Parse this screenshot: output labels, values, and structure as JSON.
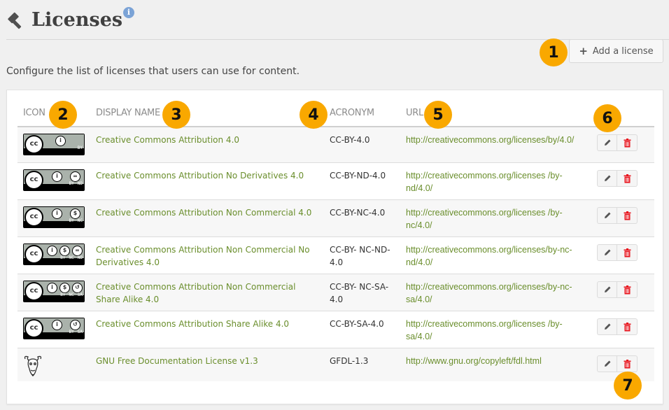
{
  "header": {
    "title": "Licenses",
    "icon": "gavel-icon",
    "info_icon": "info-icon",
    "info_glyph": "i"
  },
  "toolbar": {
    "add_label": "Add a license",
    "add_icon": "+"
  },
  "description": "Configure the list of licenses that users can use for content.",
  "table": {
    "columns": [
      "Icon",
      "Display name",
      "Acronym",
      "URL"
    ],
    "rows": [
      {
        "icon": "cc-by",
        "tags": [
          "BY"
        ],
        "name": "Creative Commons Attribution 4.0",
        "acronym": "CC-BY-4.0",
        "url": "http://creativecommons.org/licenses/by/4.0/"
      },
      {
        "icon": "cc-by-nd",
        "tags": [
          "BY",
          "ND"
        ],
        "name": "Creative Commons Attribution No Derivatives 4.0",
        "acronym": "CC-BY-ND-4.0",
        "url": "http://creativecommons.org/licenses /by-nd/4.0/"
      },
      {
        "icon": "cc-by-nc",
        "tags": [
          "BY",
          "NC"
        ],
        "name": "Creative Commons Attribution Non Commercial 4.0",
        "acronym": "CC-BY-NC-4.0",
        "url": "http://creativecommons.org/licenses /by-nc/4.0/"
      },
      {
        "icon": "cc-by-nc-nd",
        "tags": [
          "BY",
          "NC",
          "ND"
        ],
        "name": "Creative Commons Attribution Non Commercial No Derivatives 4.0",
        "acronym": "CC-BY- NC-ND-4.0",
        "url": "http://creativecommons.org/licenses/by-nc- nd/4.0/"
      },
      {
        "icon": "cc-by-nc-sa",
        "tags": [
          "BY",
          "NC",
          "SA"
        ],
        "name": "Creative Commons Attribution Non Commercial Share Alike 4.0",
        "acronym": "CC-BY- NC-SA-4.0",
        "url": "http://creativecommons.org/licenses/by-nc- sa/4.0/"
      },
      {
        "icon": "cc-by-sa",
        "tags": [
          "BY",
          "SA"
        ],
        "name": "Creative Commons Attribution Share Alike 4.0",
        "acronym": "CC-BY-SA-4.0",
        "url": "http://creativecommons.org/licenses /by-sa/4.0/"
      },
      {
        "icon": "gnu-head",
        "tags": [],
        "name": "GNU Free Documentation License v1.3",
        "acronym": "GFDL-1.3",
        "url": "http://www.gnu.org/copyleft/fdl.html"
      }
    ],
    "actions": {
      "edit_icon": "pencil-icon",
      "delete_icon": "trash-icon"
    }
  },
  "callouts": [
    "1",
    "2",
    "3",
    "4",
    "5",
    "6",
    "7"
  ],
  "colors": {
    "link": "#6a8e2c",
    "delete": "#e8121c",
    "callout": "#f9a800",
    "info": "#7ba3d6"
  }
}
